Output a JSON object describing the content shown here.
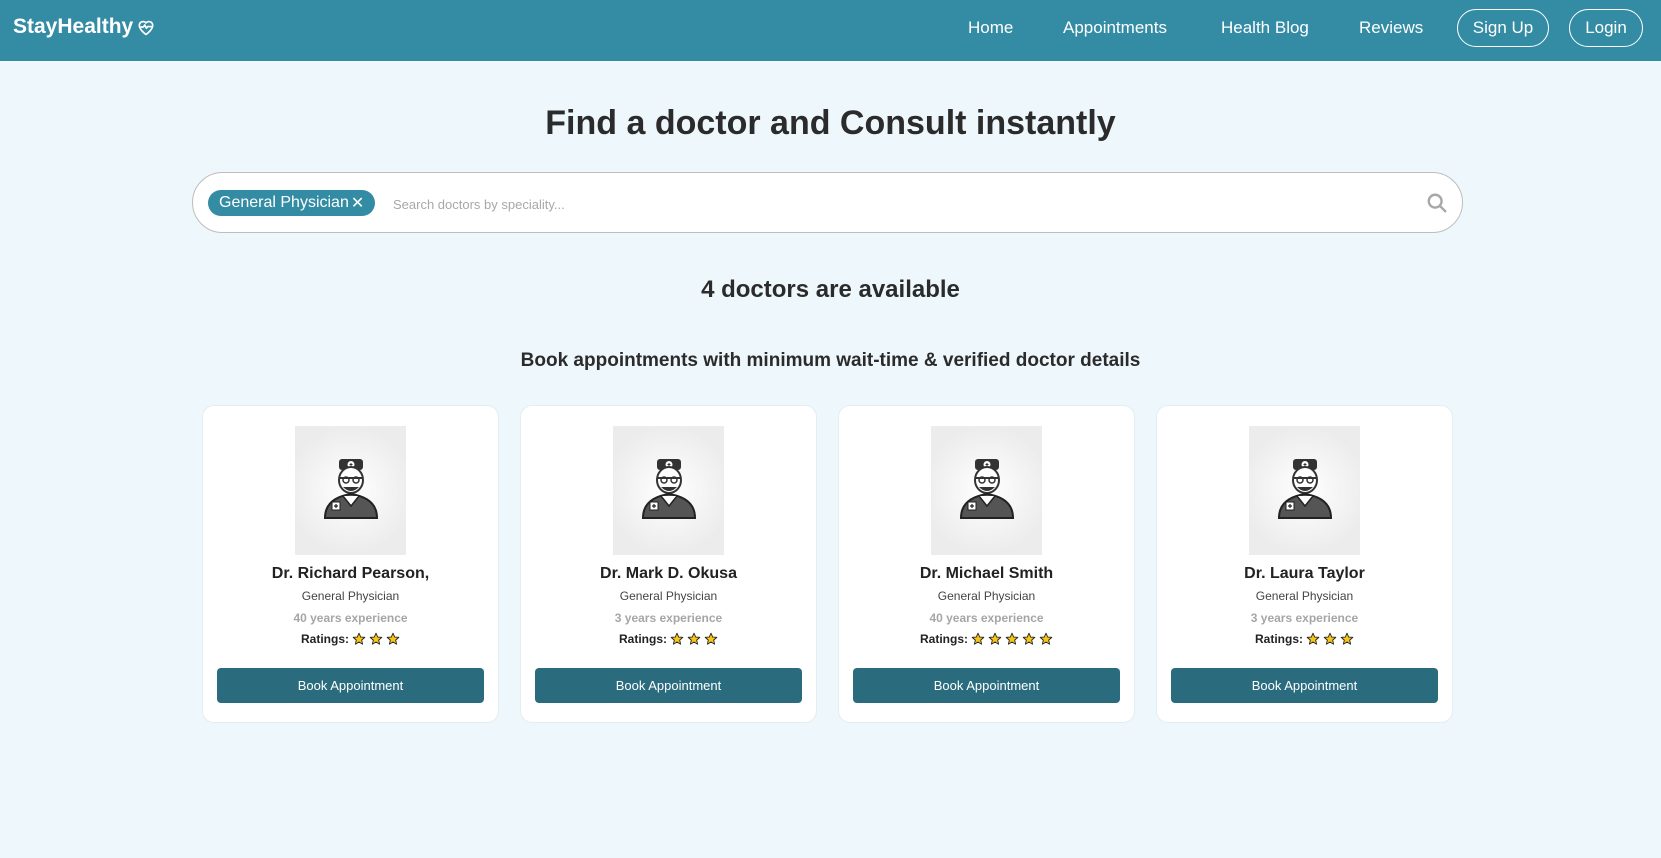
{
  "nav": {
    "brand": "StayHealthy",
    "links": [
      "Home",
      "Appointments",
      "Health Blog",
      "Reviews"
    ],
    "signup": "Sign Up",
    "login": "Login"
  },
  "title": "Find a doctor and Consult instantly",
  "search": {
    "chip": "General Physician",
    "chip_close": "✕",
    "placeholder": "Search doctors by speciality..."
  },
  "available": "4 doctors are available",
  "subtitle": "Book appointments with minimum wait-time & verified doctor details",
  "ratings_label": "Ratings:",
  "book_label": "Book Appointment",
  "colors": {
    "primary": "#338ca3",
    "button": "#2a6c7e",
    "background": "#eef8fc",
    "star": "#f5c518"
  },
  "doctors": [
    {
      "name": "Dr. Richard Pearson,",
      "speciality": "General Physician",
      "experience": "40 years experience",
      "rating": 3
    },
    {
      "name": "Dr. Mark D. Okusa",
      "speciality": "General Physician",
      "experience": "3 years experience",
      "rating": 3
    },
    {
      "name": "Dr. Michael Smith",
      "speciality": "General Physician",
      "experience": "40 years experience",
      "rating": 5
    },
    {
      "name": "Dr. Laura Taylor",
      "speciality": "General Physician",
      "experience": "3 years experience",
      "rating": 3
    }
  ]
}
